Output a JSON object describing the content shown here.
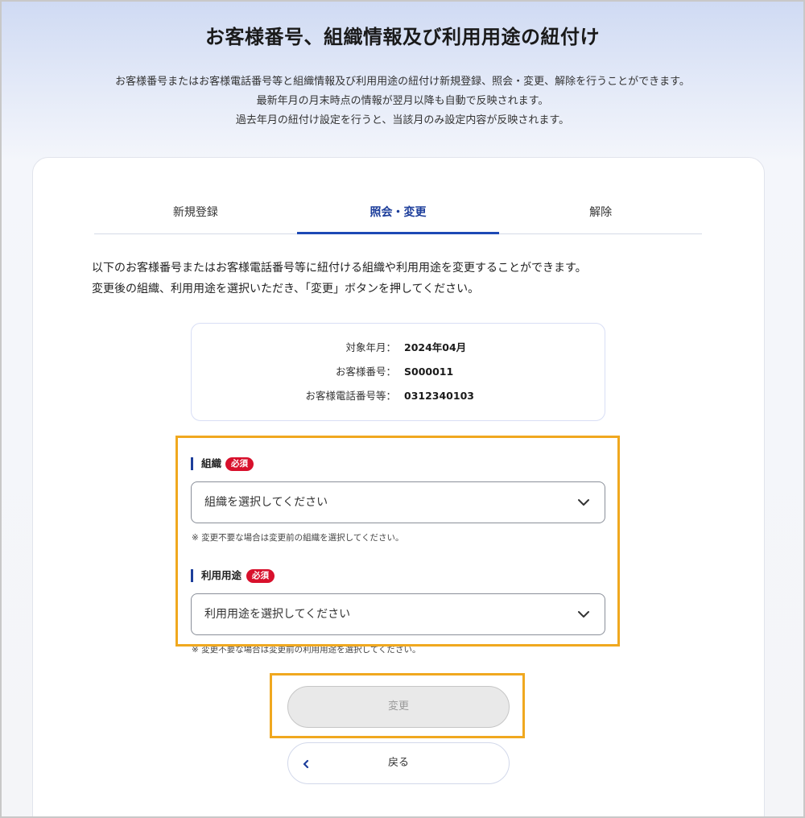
{
  "header": {
    "title": "お客様番号、組織情報及び利用用途の紐付け",
    "intro": [
      "お客様番号またはお客様電話番号等と組織情報及び利用用途の紐付け新規登録、照会・変更、解除を行うことができます。",
      "最新年月の月末時点の情報が翌月以降も自動で反映されます。",
      "過去年月の紐付け設定を行うと、当該月のみ設定内容が反映されます。"
    ]
  },
  "tabs": [
    {
      "label": "新規登録",
      "active": false
    },
    {
      "label": "照会・変更",
      "active": true
    },
    {
      "label": "解除",
      "active": false
    }
  ],
  "description": [
    "以下のお客様番号またはお客様電話番号等に紐付ける組織や利用用途を変更することができます。",
    "変更後の組織、利用用途を選択いただき、「変更」ボタンを押してください。"
  ],
  "info": {
    "target_month_label": "対象年月：",
    "target_month_value": "2024年04月",
    "customer_no_label": "お客様番号：",
    "customer_no_value": "S000011",
    "phone_label": "お客様電話番号等：",
    "phone_value": "0312340103"
  },
  "form": {
    "organization": {
      "label": "組織",
      "required": "必須",
      "placeholder": "組織を選択してください",
      "note": "※ 変更不要な場合は変更前の組織を選択してください。"
    },
    "usage": {
      "label": "利用用途",
      "required": "必須",
      "placeholder": "利用用途を選択してください",
      "note": "※ 変更不要な場合は変更前の利用用途を選択してください。"
    }
  },
  "buttons": {
    "change": "変更",
    "back": "戻る"
  },
  "colors": {
    "accent": "#1d3e9b",
    "required_badge": "#d8102c",
    "highlight": "#f0a81f"
  }
}
